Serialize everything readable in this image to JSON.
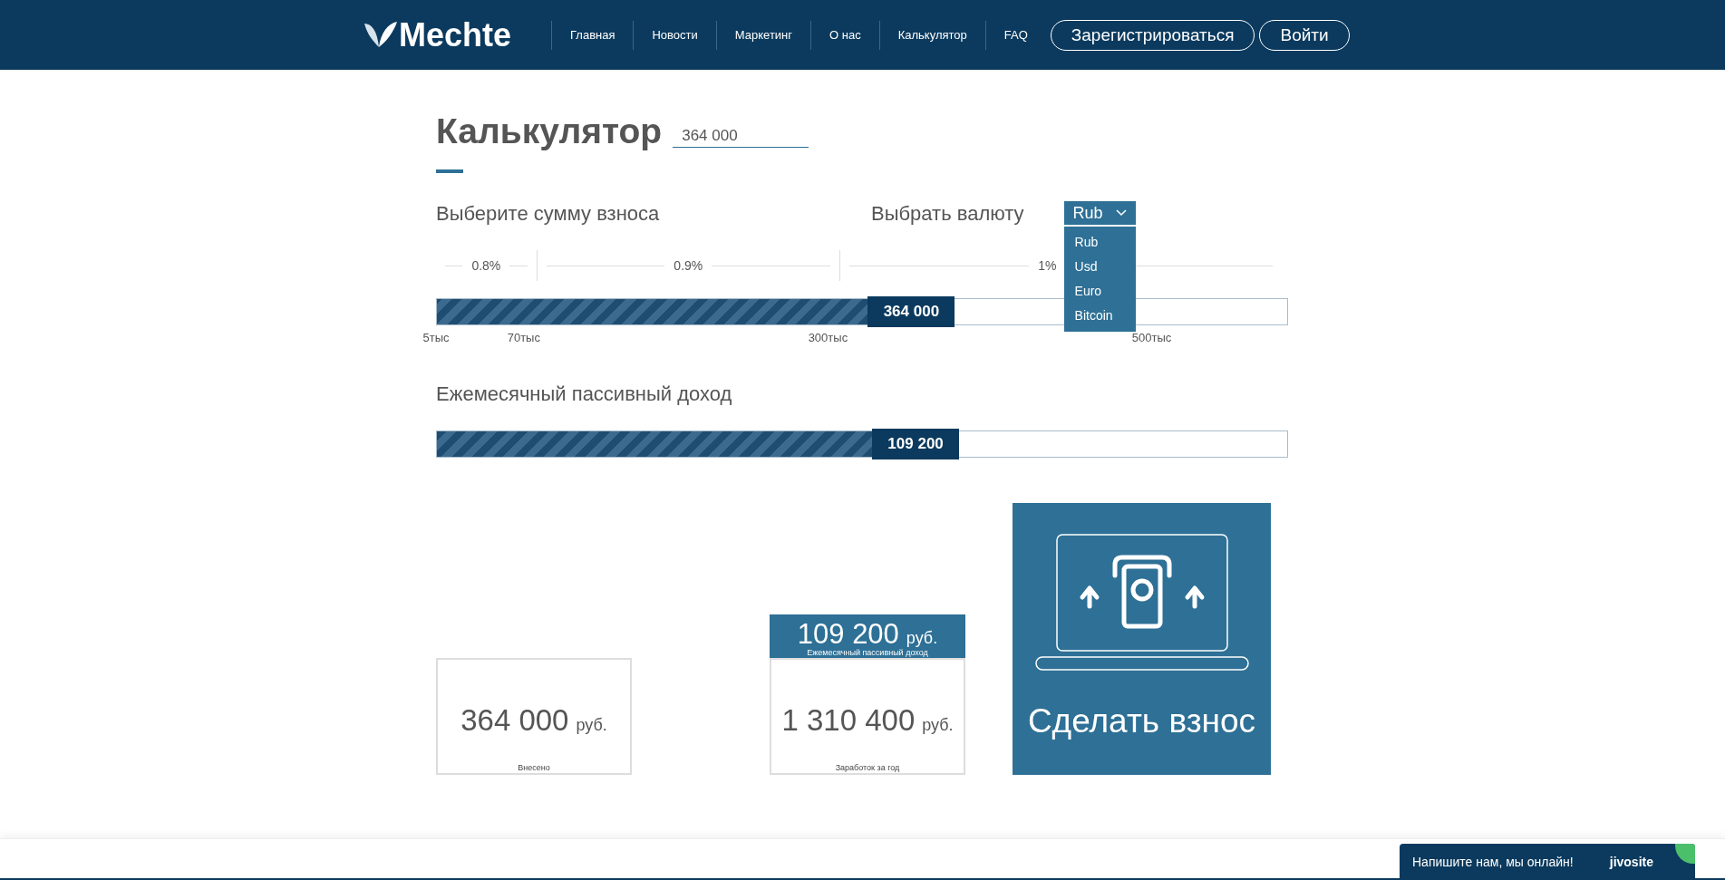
{
  "header": {
    "logo": "Mechte",
    "nav": [
      {
        "label": "Главная"
      },
      {
        "label": "Новости"
      },
      {
        "label": "Маркетинг"
      },
      {
        "label": "О нас"
      },
      {
        "label": "Калькулятор"
      },
      {
        "label": "FAQ"
      }
    ],
    "buttons": [
      {
        "label": "Зарегистрироваться"
      },
      {
        "label": "Войти"
      }
    ]
  },
  "calculator": {
    "title": "Калькулятор",
    "amount_field": {
      "value": "364 000"
    },
    "deposit_label": "Выберите сумму взноса",
    "currency_label": "Выбрать валюту",
    "currency": {
      "value": "Rub",
      "expanded": true,
      "options": [
        {
          "label": "Rub"
        },
        {
          "label": "Usd"
        },
        {
          "label": "Euro"
        },
        {
          "label": "Bitcoin"
        }
      ]
    },
    "rates": [
      "0.8%",
      "0.9%",
      "1%"
    ],
    "deposit_slider": {
      "value": "364 000",
      "level": 0.558
    },
    "scale": [
      "5тыс",
      "70тыс",
      "300тыс",
      "500тыс"
    ],
    "income_label": "Ежемесячный пассивный доход",
    "income_slider": {
      "value": "109 200",
      "level": 0.563
    },
    "deposited_card": {
      "amount": "364 000",
      "unit": "руб.",
      "caption": "Внесено"
    },
    "year_card": {
      "monthly_amount": "109 200",
      "monthly_unit": "руб.",
      "monthly_caption": "Ежемесячный пассивный доход",
      "amount": "1 310 400",
      "unit": "руб.",
      "caption": "Заработок за год"
    },
    "deposit_button": "Сделать взнос"
  },
  "chat": {
    "text": "Напишите нам, мы онлайн!",
    "brand": "jivosite"
  }
}
